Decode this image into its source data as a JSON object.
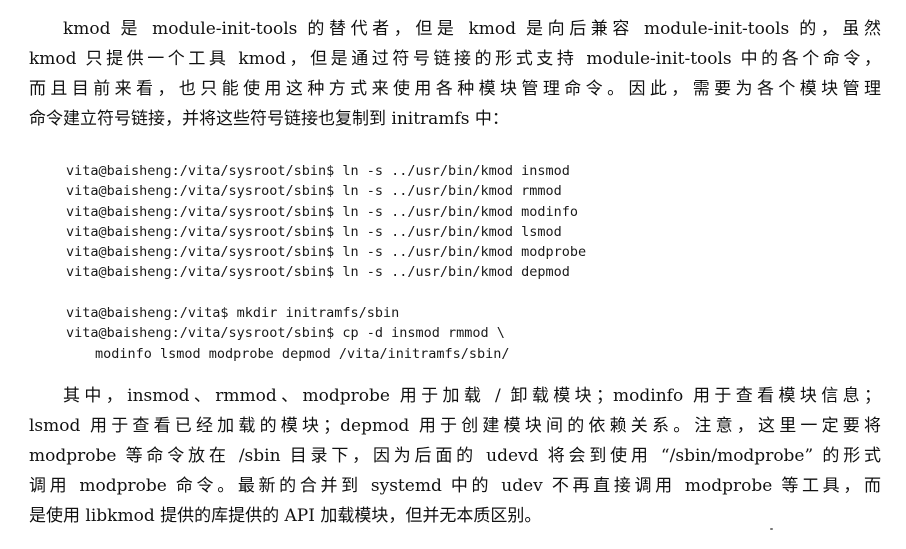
{
  "intro_paragraph": {
    "lines": [
      "kmod 是 module-init-tools 的替代者，但是 kmod 是向后兼容 module-init-tools 的，虽然",
      "kmod 只提供一个工具 kmod，但是通过符号链接的形式支持 module-init-tools 中的各个命令，",
      "而且目前来看，也只能使用这种方式来使用各种模块管理命令。因此，需要为各个模块管理",
      "命令建立符号链接，并将这些符号链接也复制到 initramfs 中："
    ]
  },
  "code_block_links": {
    "lines": [
      "vita@baisheng:/vita/sysroot/sbin$ ln -s ../usr/bin/kmod insmod",
      "vita@baisheng:/vita/sysroot/sbin$ ln -s ../usr/bin/kmod rmmod",
      "vita@baisheng:/vita/sysroot/sbin$ ln -s ../usr/bin/kmod modinfo",
      "vita@baisheng:/vita/sysroot/sbin$ ln -s ../usr/bin/kmod lsmod",
      "vita@baisheng:/vita/sysroot/sbin$ ln -s ../usr/bin/kmod modprobe",
      "vita@baisheng:/vita/sysroot/sbin$ ln -s ../usr/bin/kmod depmod"
    ]
  },
  "code_block_copy": {
    "lines": [
      "vita@baisheng:/vita$ mkdir initramfs/sbin",
      "vita@baisheng:/vita/sysroot/sbin$ cp -d insmod rmmod \\",
      "modinfo lsmod modprobe depmod /vita/initramfs/sbin/"
    ]
  },
  "explanation_paragraph": {
    "lines": [
      "其中，insmod、rmmod、modprobe 用于加载 / 卸载模块；modinfo 用于查看模块信息；",
      "lsmod 用于查看已经加载的模块；depmod 用于创建模块间的依赖关系。注意，这里一定要将",
      "modprobe 等命令放在 /sbin 目录下，因为后面的 udevd 将会到使用 “/sbin/modprobe” 的形式",
      "调用 modprobe 命令。最新的合并到 systemd 中的 udev 不再直接调用 modprobe 等工具，而",
      "是使用 libkmod 提供的库提供的 API 加载模块，但并无本质区别。"
    ]
  }
}
